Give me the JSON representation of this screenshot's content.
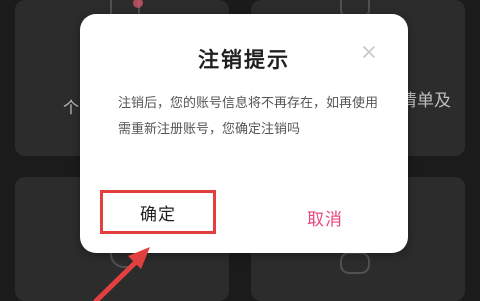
{
  "background": {
    "left_card_text": "个",
    "right_card_text": "清单及"
  },
  "dialog": {
    "title": "注销提示",
    "message": "注销后，您的账号信息将不再存在，如再使用需重新注册账号，您确定注销吗",
    "confirm_label": "确定",
    "cancel_label": "取消",
    "close_icon": "close-icon"
  },
  "colors": {
    "highlight_box": "#e2403f",
    "cancel_text": "#e8477b",
    "arrow": "#e2403f"
  }
}
